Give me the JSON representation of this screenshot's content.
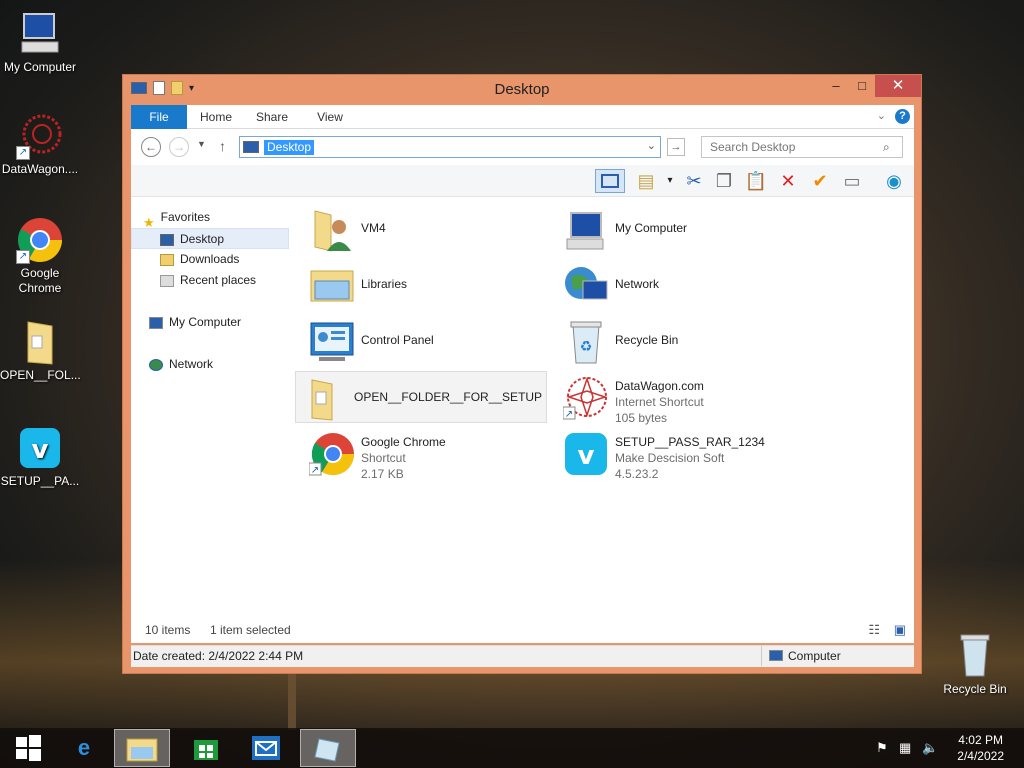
{
  "desktop_icons": [
    {
      "label": "My Computer",
      "icon": "computer-icon"
    },
    {
      "label": "DataWagon....",
      "icon": "datawagon-icon"
    },
    {
      "label": "Google Chrome",
      "icon": "chrome-icon"
    },
    {
      "label": "OPEN__FOL...",
      "icon": "folder-icon"
    },
    {
      "label": "SETUP__PA...",
      "icon": "vimeo-icon"
    },
    {
      "label": "Recycle Bin",
      "icon": "recycle-bin-icon"
    }
  ],
  "window": {
    "title": "Desktop",
    "ribbon_tabs": [
      "File",
      "Home",
      "Share",
      "View"
    ],
    "address": "Desktop",
    "search_placeholder": "Search Desktop",
    "nav": {
      "favorites": "Favorites",
      "desktop": "Desktop",
      "downloads": "Downloads",
      "recent": "Recent places",
      "computer": "My Computer",
      "network": "Network"
    },
    "items": [
      {
        "name": "VM4",
        "sub": "",
        "sub2": ""
      },
      {
        "name": "My Computer",
        "sub": "",
        "sub2": ""
      },
      {
        "name": "Libraries",
        "sub": "",
        "sub2": ""
      },
      {
        "name": "Network",
        "sub": "",
        "sub2": ""
      },
      {
        "name": "Control Panel",
        "sub": "",
        "sub2": ""
      },
      {
        "name": "Recycle Bin",
        "sub": "",
        "sub2": ""
      },
      {
        "name": "OPEN__FOLDER__FOR__SETUP",
        "sub": "",
        "sub2": ""
      },
      {
        "name": "DataWagon.com",
        "sub": "Internet Shortcut",
        "sub2": "105 bytes"
      },
      {
        "name": "Google Chrome",
        "sub": "Shortcut",
        "sub2": "2.17 KB"
      },
      {
        "name": "SETUP__PASS_RAR_1234",
        "sub": "Make Descision Soft",
        "sub2": "4.5.23.2"
      }
    ],
    "status": {
      "count": "10 items",
      "selected": "1 item selected"
    },
    "details": {
      "date_created": "Date created: 2/4/2022 2:44 PM",
      "location": "Computer"
    }
  },
  "taskbar": {
    "time": "4:02 PM",
    "date": "2/4/2022"
  },
  "colors": {
    "title_bar": "#e8956b",
    "close_button": "#c7504f",
    "file_tab": "#1979ca",
    "selection": "#3399ff"
  }
}
